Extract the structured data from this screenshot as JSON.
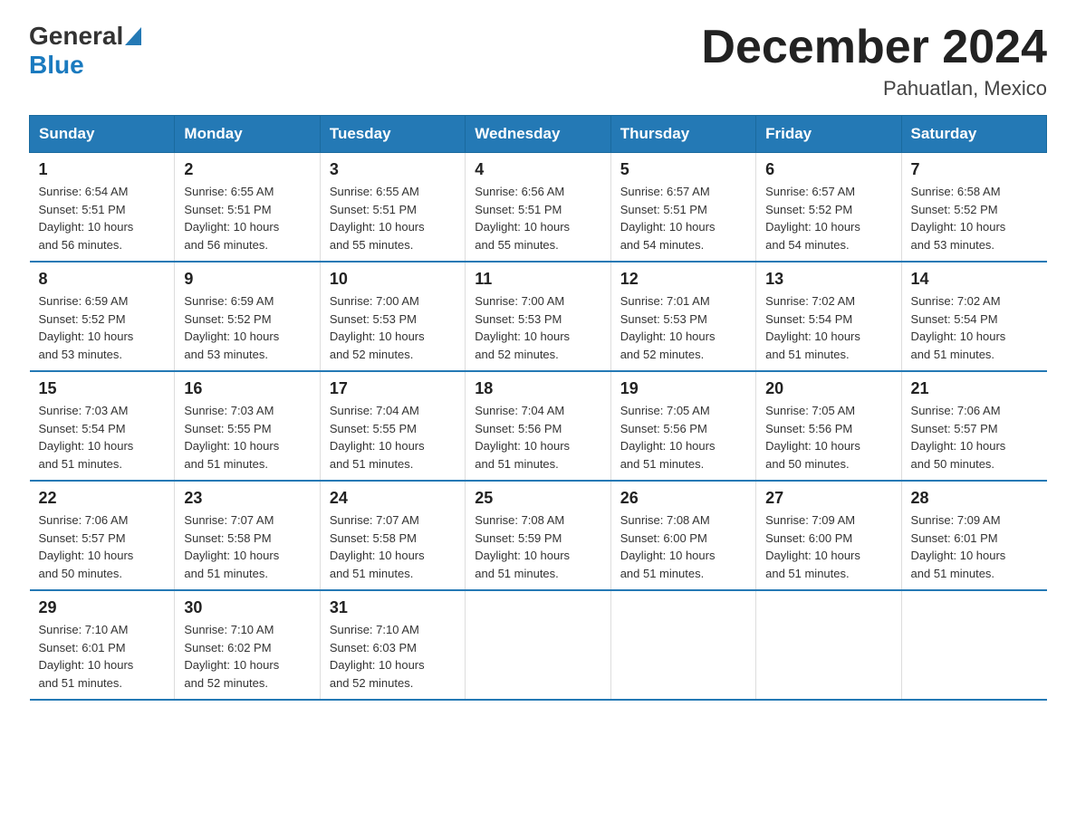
{
  "header": {
    "logo": {
      "general": "General",
      "blue": "Blue"
    },
    "title": "December 2024",
    "location": "Pahuatlan, Mexico"
  },
  "weekdays": [
    "Sunday",
    "Monday",
    "Tuesday",
    "Wednesday",
    "Thursday",
    "Friday",
    "Saturday"
  ],
  "weeks": [
    [
      {
        "day": 1,
        "sunrise": "6:54 AM",
        "sunset": "5:51 PM",
        "daylight": "10 hours and 56 minutes."
      },
      {
        "day": 2,
        "sunrise": "6:55 AM",
        "sunset": "5:51 PM",
        "daylight": "10 hours and 56 minutes."
      },
      {
        "day": 3,
        "sunrise": "6:55 AM",
        "sunset": "5:51 PM",
        "daylight": "10 hours and 55 minutes."
      },
      {
        "day": 4,
        "sunrise": "6:56 AM",
        "sunset": "5:51 PM",
        "daylight": "10 hours and 55 minutes."
      },
      {
        "day": 5,
        "sunrise": "6:57 AM",
        "sunset": "5:51 PM",
        "daylight": "10 hours and 54 minutes."
      },
      {
        "day": 6,
        "sunrise": "6:57 AM",
        "sunset": "5:52 PM",
        "daylight": "10 hours and 54 minutes."
      },
      {
        "day": 7,
        "sunrise": "6:58 AM",
        "sunset": "5:52 PM",
        "daylight": "10 hours and 53 minutes."
      }
    ],
    [
      {
        "day": 8,
        "sunrise": "6:59 AM",
        "sunset": "5:52 PM",
        "daylight": "10 hours and 53 minutes."
      },
      {
        "day": 9,
        "sunrise": "6:59 AM",
        "sunset": "5:52 PM",
        "daylight": "10 hours and 53 minutes."
      },
      {
        "day": 10,
        "sunrise": "7:00 AM",
        "sunset": "5:53 PM",
        "daylight": "10 hours and 52 minutes."
      },
      {
        "day": 11,
        "sunrise": "7:00 AM",
        "sunset": "5:53 PM",
        "daylight": "10 hours and 52 minutes."
      },
      {
        "day": 12,
        "sunrise": "7:01 AM",
        "sunset": "5:53 PM",
        "daylight": "10 hours and 52 minutes."
      },
      {
        "day": 13,
        "sunrise": "7:02 AM",
        "sunset": "5:54 PM",
        "daylight": "10 hours and 51 minutes."
      },
      {
        "day": 14,
        "sunrise": "7:02 AM",
        "sunset": "5:54 PM",
        "daylight": "10 hours and 51 minutes."
      }
    ],
    [
      {
        "day": 15,
        "sunrise": "7:03 AM",
        "sunset": "5:54 PM",
        "daylight": "10 hours and 51 minutes."
      },
      {
        "day": 16,
        "sunrise": "7:03 AM",
        "sunset": "5:55 PM",
        "daylight": "10 hours and 51 minutes."
      },
      {
        "day": 17,
        "sunrise": "7:04 AM",
        "sunset": "5:55 PM",
        "daylight": "10 hours and 51 minutes."
      },
      {
        "day": 18,
        "sunrise": "7:04 AM",
        "sunset": "5:56 PM",
        "daylight": "10 hours and 51 minutes."
      },
      {
        "day": 19,
        "sunrise": "7:05 AM",
        "sunset": "5:56 PM",
        "daylight": "10 hours and 51 minutes."
      },
      {
        "day": 20,
        "sunrise": "7:05 AM",
        "sunset": "5:56 PM",
        "daylight": "10 hours and 50 minutes."
      },
      {
        "day": 21,
        "sunrise": "7:06 AM",
        "sunset": "5:57 PM",
        "daylight": "10 hours and 50 minutes."
      }
    ],
    [
      {
        "day": 22,
        "sunrise": "7:06 AM",
        "sunset": "5:57 PM",
        "daylight": "10 hours and 50 minutes."
      },
      {
        "day": 23,
        "sunrise": "7:07 AM",
        "sunset": "5:58 PM",
        "daylight": "10 hours and 51 minutes."
      },
      {
        "day": 24,
        "sunrise": "7:07 AM",
        "sunset": "5:58 PM",
        "daylight": "10 hours and 51 minutes."
      },
      {
        "day": 25,
        "sunrise": "7:08 AM",
        "sunset": "5:59 PM",
        "daylight": "10 hours and 51 minutes."
      },
      {
        "day": 26,
        "sunrise": "7:08 AM",
        "sunset": "6:00 PM",
        "daylight": "10 hours and 51 minutes."
      },
      {
        "day": 27,
        "sunrise": "7:09 AM",
        "sunset": "6:00 PM",
        "daylight": "10 hours and 51 minutes."
      },
      {
        "day": 28,
        "sunrise": "7:09 AM",
        "sunset": "6:01 PM",
        "daylight": "10 hours and 51 minutes."
      }
    ],
    [
      {
        "day": 29,
        "sunrise": "7:10 AM",
        "sunset": "6:01 PM",
        "daylight": "10 hours and 51 minutes."
      },
      {
        "day": 30,
        "sunrise": "7:10 AM",
        "sunset": "6:02 PM",
        "daylight": "10 hours and 52 minutes."
      },
      {
        "day": 31,
        "sunrise": "7:10 AM",
        "sunset": "6:03 PM",
        "daylight": "10 hours and 52 minutes."
      },
      null,
      null,
      null,
      null
    ]
  ],
  "labels": {
    "sunrise": "Sunrise: ",
    "sunset": "Sunset: ",
    "daylight": "Daylight: "
  }
}
